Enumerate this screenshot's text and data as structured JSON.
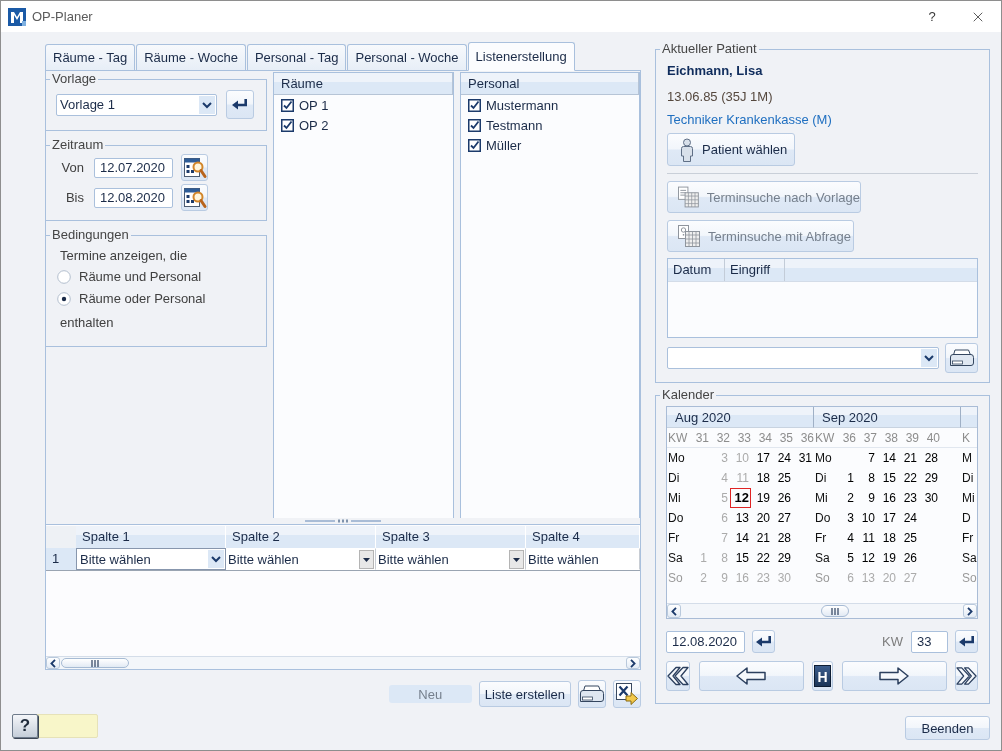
{
  "window": {
    "title": "OP-Planer",
    "help": "?"
  },
  "tabs": [
    {
      "label": "Räume - Tag",
      "selected": false
    },
    {
      "label": "Räume - Woche",
      "selected": false
    },
    {
      "label": "Personal - Tag",
      "selected": false
    },
    {
      "label": "Personal - Woche",
      "selected": false
    },
    {
      "label": "Listenerstellung",
      "selected": true
    }
  ],
  "template": {
    "title": "Vorlage",
    "value": "Vorlage 1"
  },
  "period": {
    "title": "Zeitraum",
    "from_label": "Von",
    "from": "12.07.2020",
    "to_label": "Bis",
    "to": "12.08.2020"
  },
  "conditions": {
    "title": "Bedingungen",
    "intro": "Termine anzeigen, die",
    "options": [
      {
        "label": "Räume und Personal",
        "selected": false
      },
      {
        "label": "Räume oder Personal",
        "selected": true
      }
    ],
    "outro": "enthalten"
  },
  "rooms": {
    "title": "Räume",
    "items": [
      {
        "label": "OP 1",
        "checked": true
      },
      {
        "label": "OP 2",
        "checked": true
      }
    ]
  },
  "staff": {
    "title": "Personal",
    "items": [
      {
        "label": "Mustermann",
        "checked": true
      },
      {
        "label": "Testmann",
        "checked": true
      },
      {
        "label": "Müller",
        "checked": true
      }
    ]
  },
  "grid": {
    "columns": [
      "Spalte 1",
      "Spalte 2",
      "Spalte 3",
      "Spalte 4"
    ],
    "rows": [
      {
        "label": "1",
        "cells": [
          {
            "value": "Bitte wählen",
            "selected": true
          },
          {
            "value": "Bitte wählen",
            "selected": false
          },
          {
            "value": "Bitte wählen",
            "selected": false
          },
          {
            "value": "Bitte wählen",
            "selected": false
          }
        ]
      }
    ]
  },
  "actions": [
    {
      "kind": "text",
      "label": "Neu",
      "disabled": true
    },
    {
      "kind": "text",
      "label": "Liste erstellen",
      "disabled": false
    },
    {
      "kind": "print"
    },
    {
      "kind": "export"
    }
  ],
  "help_key": {
    "label": "?"
  },
  "patient": {
    "title": "Aktueller Patient",
    "name": "Eichmann, Lisa",
    "birth": "13.06.85 (35J 1M)",
    "insurance": "Techniker Krankenkasse (M)",
    "select_button": "Patient wählen",
    "search_buttons": [
      {
        "kind": "template",
        "label": "Terminsuche nach Vorlage",
        "disabled": true
      },
      {
        "kind": "query",
        "label": "Terminsuche mit Abfrage",
        "disabled": true
      }
    ],
    "table": {
      "columns": [
        "Datum",
        "Eingriff"
      ]
    }
  },
  "calendar": {
    "title": "Kalender",
    "months": [
      {
        "title": "Aug 2020",
        "kw_label": "KW",
        "weekdays": [
          {
            "text": "Mo",
            "muted": false
          },
          {
            "text": "Di",
            "muted": false
          },
          {
            "text": "Mi",
            "muted": false
          },
          {
            "text": "Do",
            "muted": false
          },
          {
            "text": "Fr",
            "muted": false
          },
          {
            "text": "Sa",
            "muted": false
          },
          {
            "text": "So",
            "muted": true
          }
        ],
        "weeks": [
          {
            "kw": "31",
            "days": [
              {
                "text": "1",
                "muted": true,
                "selected": false
              },
              {
                "text": "2",
                "muted": true,
                "selected": false
              }
            ]
          },
          {
            "kw": "32",
            "days": [
              {
                "text": "3",
                "muted": true,
                "selected": false
              },
              {
                "text": "4",
                "muted": true,
                "selected": false
              },
              {
                "text": "5",
                "muted": true,
                "selected": false
              },
              {
                "text": "6",
                "muted": true,
                "selected": false
              },
              {
                "text": "7",
                "muted": true,
                "selected": false
              },
              {
                "text": "8",
                "muted": true,
                "selected": false
              },
              {
                "text": "9",
                "muted": true,
                "selected": false
              }
            ]
          },
          {
            "kw": "33",
            "days": [
              {
                "text": "10",
                "muted": true,
                "selected": false
              },
              {
                "text": "11",
                "muted": true,
                "selected": false
              },
              {
                "text": "12",
                "muted": false,
                "selected": true
              },
              {
                "text": "13",
                "muted": false,
                "selected": false
              },
              {
                "text": "14",
                "muted": false,
                "selected": false
              },
              {
                "text": "15",
                "muted": false,
                "selected": false
              },
              {
                "text": "16",
                "muted": true,
                "selected": false
              }
            ]
          },
          {
            "kw": "34",
            "days": [
              {
                "text": "17",
                "muted": false,
                "selected": false
              },
              {
                "text": "18",
                "muted": false,
                "selected": false
              },
              {
                "text": "19",
                "muted": false,
                "selected": false
              },
              {
                "text": "20",
                "muted": false,
                "selected": false
              },
              {
                "text": "21",
                "muted": false,
                "selected": false
              },
              {
                "text": "22",
                "muted": false,
                "selected": false
              },
              {
                "text": "23",
                "muted": true,
                "selected": false
              }
            ]
          },
          {
            "kw": "35",
            "days": [
              {
                "text": "24",
                "muted": false,
                "selected": false
              },
              {
                "text": "25",
                "muted": false,
                "selected": false
              },
              {
                "text": "26",
                "muted": false,
                "selected": false
              },
              {
                "text": "27",
                "muted": false,
                "selected": false
              },
              {
                "text": "28",
                "muted": false,
                "selected": false
              },
              {
                "text": "29",
                "muted": false,
                "selected": false
              },
              {
                "text": "30",
                "muted": true,
                "selected": false
              }
            ]
          },
          {
            "kw": "36",
            "days": [
              {
                "text": "31",
                "muted": false,
                "selected": false
              }
            ]
          }
        ]
      },
      {
        "title": "Sep 2020",
        "kw_label": "KW",
        "weekdays": [
          {
            "text": "Mo",
            "muted": false
          },
          {
            "text": "Di",
            "muted": false
          },
          {
            "text": "Mi",
            "muted": false
          },
          {
            "text": "Do",
            "muted": false
          },
          {
            "text": "Fr",
            "muted": false
          },
          {
            "text": "Sa",
            "muted": false
          },
          {
            "text": "So",
            "muted": true
          }
        ],
        "weeks": [
          {
            "kw": "36",
            "days": [
              {
                "text": "1",
                "muted": false,
                "selected": false
              },
              {
                "text": "2",
                "muted": false,
                "selected": false
              },
              {
                "text": "3",
                "muted": false,
                "selected": false
              },
              {
                "text": "4",
                "muted": false,
                "selected": false
              },
              {
                "text": "5",
                "muted": false,
                "selected": false
              },
              {
                "text": "6",
                "muted": true,
                "selected": false
              }
            ]
          },
          {
            "kw": "37",
            "days": [
              {
                "text": "7",
                "muted": false,
                "selected": false
              },
              {
                "text": "8",
                "muted": false,
                "selected": false
              },
              {
                "text": "9",
                "muted": false,
                "selected": false
              },
              {
                "text": "10",
                "muted": false,
                "selected": false
              },
              {
                "text": "11",
                "muted": false,
                "selected": false
              },
              {
                "text": "12",
                "muted": false,
                "selected": false
              },
              {
                "text": "13",
                "muted": true,
                "selected": false
              }
            ]
          },
          {
            "kw": "38",
            "days": [
              {
                "text": "14",
                "muted": false,
                "selected": false
              },
              {
                "text": "15",
                "muted": false,
                "selected": false
              },
              {
                "text": "16",
                "muted": false,
                "selected": false
              },
              {
                "text": "17",
                "muted": false,
                "selected": false
              },
              {
                "text": "18",
                "muted": false,
                "selected": false
              },
              {
                "text": "19",
                "muted": false,
                "selected": false
              },
              {
                "text": "20",
                "muted": true,
                "selected": false
              }
            ]
          },
          {
            "kw": "39",
            "days": [
              {
                "text": "21",
                "muted": false,
                "selected": false
              },
              {
                "text": "22",
                "muted": false,
                "selected": false
              },
              {
                "text": "23",
                "muted": false,
                "selected": false
              },
              {
                "text": "24",
                "muted": false,
                "selected": false
              },
              {
                "text": "25",
                "muted": false,
                "selected": false
              },
              {
                "text": "26",
                "muted": false,
                "selected": false
              },
              {
                "text": "27",
                "muted": true,
                "selected": false
              }
            ]
          },
          {
            "kw": "40",
            "days": [
              {
                "text": "28",
                "muted": false,
                "selected": false
              },
              {
                "text": "29",
                "muted": false,
                "selected": false
              },
              {
                "text": "30",
                "muted": false,
                "selected": false
              }
            ]
          }
        ]
      },
      {
        "kw_label": "K",
        "weekdays": [
          {
            "text": "M",
            "muted": false
          },
          {
            "text": "Di",
            "muted": false
          },
          {
            "text": "Mi",
            "muted": false
          },
          {
            "text": "D",
            "muted": false
          },
          {
            "text": "Fr",
            "muted": false
          },
          {
            "text": "Sa",
            "muted": false
          },
          {
            "text": "So",
            "muted": true
          }
        ]
      }
    ],
    "date": "12.08.2020",
    "week_label": "KW",
    "week": "33",
    "today": "H"
  },
  "close_button": "Beenden"
}
